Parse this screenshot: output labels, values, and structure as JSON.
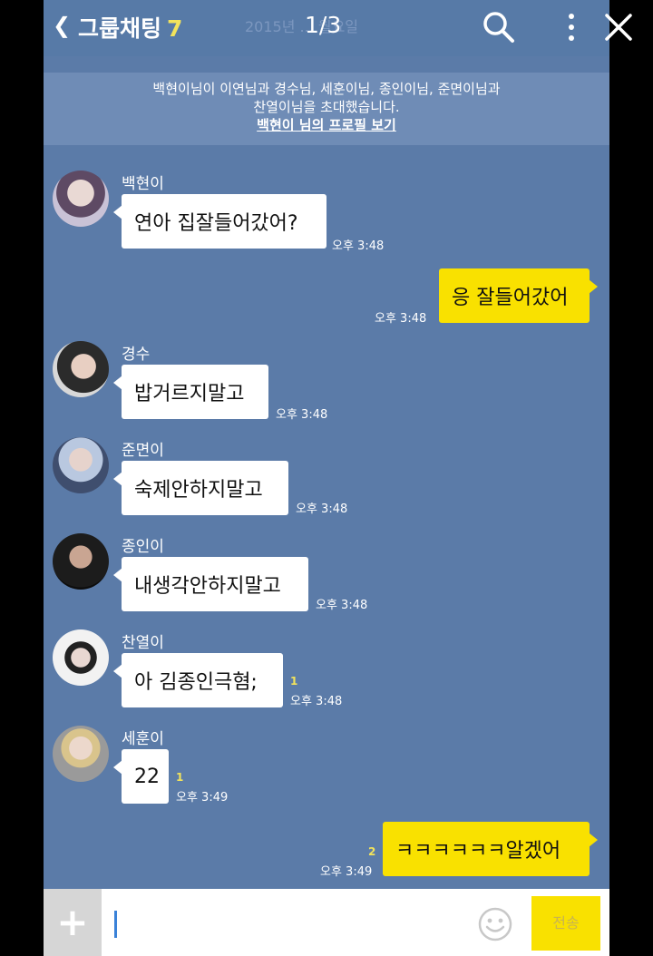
{
  "header": {
    "back_icon": "chevron-left-icon",
    "title": "그룹채팅",
    "member_count": "7",
    "faded_date": "2015년 ... 월요일",
    "pager": "1/3",
    "icons": [
      "search-icon",
      "more-vertical-icon",
      "close-icon"
    ]
  },
  "notice": {
    "line1": "백현이님이 이연님과 경수님, 세훈이님, 종인이님, 준면이님과",
    "line2": "찬열이님을 초대했습니다.",
    "link": "백현이 님의 프로필 보기"
  },
  "messages": [
    {
      "sender": "백현이",
      "text": "연아 집잘들어갔어?",
      "time": "오후 3:48",
      "unread": ""
    },
    {
      "sender": "",
      "text": "응 잘들어갔어",
      "time": "오후 3:48",
      "unread": ""
    },
    {
      "sender": "경수",
      "text": "밥거르지말고",
      "time": "오후 3:48",
      "unread": ""
    },
    {
      "sender": "준면이",
      "text": "숙제안하지말고",
      "time": "오후 3:48",
      "unread": ""
    },
    {
      "sender": "종인이",
      "text": "내생각안하지말고",
      "time": "오후 3:48",
      "unread": ""
    },
    {
      "sender": "찬열이",
      "text": "아 김종인극혐;",
      "time": "오후 3:48",
      "unread": "1"
    },
    {
      "sender": "세훈이",
      "text": "22",
      "time": "오후 3:49",
      "unread": "1"
    },
    {
      "sender": "",
      "text": "ㅋㅋㅋㅋㅋㅋ알겠어",
      "time": "오후 3:49",
      "unread": "2"
    }
  ],
  "input": {
    "plus_icon": "plus-icon",
    "emoji_icon": "emoji-icon",
    "send_label": "전송"
  },
  "colors": {
    "chat_background": "#5b7ba8",
    "outgoing_bubble": "#f9e100",
    "incoming_bubble": "#ffffff",
    "unread_count": "#f2e35c"
  }
}
